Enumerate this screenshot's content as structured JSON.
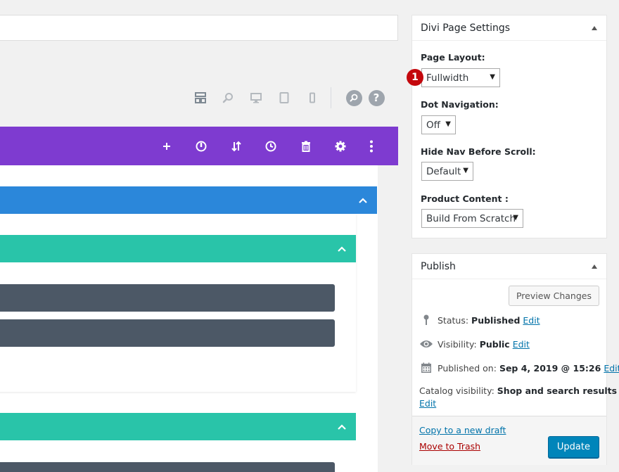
{
  "toolbar": {
    "icons": [
      "wireframe-view-icon",
      "zoom-icon",
      "desktop-view-icon",
      "tablet-view-icon",
      "phone-view-icon",
      "search-icon",
      "help-icon"
    ],
    "help_label": "?"
  },
  "section_toolbar": {
    "icons": [
      "add-icon",
      "power-icon",
      "sort-icon",
      "history-icon",
      "trash-icon",
      "settings-icon",
      "more-icon"
    ],
    "colors": {
      "section": "#7e3bd0",
      "row": "#2b87da",
      "column": "#29c4a9",
      "module": "#4c5866"
    }
  },
  "page_settings": {
    "title": "Divi Page Settings",
    "badge": "1",
    "fields": [
      {
        "label": "Page Layout:",
        "value": "Fullwidth"
      },
      {
        "label": "Dot Navigation:",
        "value": "Off"
      },
      {
        "label": "Hide Nav Before Scroll:",
        "value": "Default"
      },
      {
        "label": "Product Content :",
        "value": "Build From Scratch"
      }
    ]
  },
  "publish": {
    "title": "Publish",
    "preview_label": "Preview Changes",
    "status_label": "Status:",
    "status_value": "Published",
    "visibility_label": "Visibility:",
    "visibility_value": "Public",
    "published_label": "Published on:",
    "published_value": "Sep 4, 2019 @ 15:26",
    "edit_label": "Edit",
    "catalog_label": "Catalog visibility:",
    "catalog_value": "Shop and search results",
    "copy_draft": "Copy to a new draft",
    "trash": "Move to Trash",
    "update_label": "Update"
  }
}
